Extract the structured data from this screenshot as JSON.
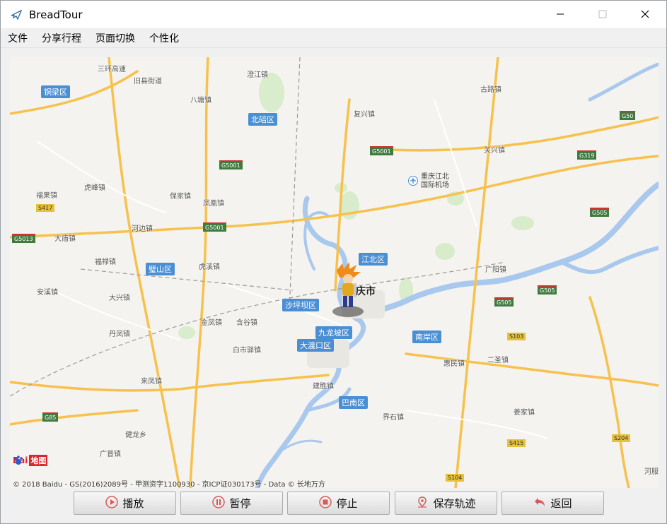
{
  "window": {
    "title": "BreadTour",
    "icon": "airplane-icon"
  },
  "window_controls": {
    "minimize": "minimize-icon",
    "maximize": "maximize-icon",
    "close": "close-icon"
  },
  "menu": {
    "items": [
      {
        "label": "文件"
      },
      {
        "label": "分享行程"
      },
      {
        "label": "页面切换"
      },
      {
        "label": "个性化"
      }
    ]
  },
  "map": {
    "colors": {
      "land": "#f4f3ef",
      "water": "#a9c8ee",
      "highway": "#f7c14d",
      "green": "#cde7c0",
      "district_label": "#4a8fd4"
    },
    "places": [
      "三环高速",
      "旧县街道",
      "澄江镇",
      "古路镇",
      "八塘镇",
      "复兴镇",
      "关兴镇",
      "福果镇",
      "虎峰镇",
      "保家镇",
      "凤凰镇",
      "河边镇",
      "大庙镇",
      "福禄镇",
      "虎溪镇",
      "广阳镇",
      "安溪镇",
      "大兴镇",
      "金凤镇",
      "含谷镇",
      "丹凤镇",
      "白市驿镇",
      "惠民镇",
      "二圣镇",
      "来凤镇",
      "建胜镇",
      "界石镇",
      "姜家镇",
      "健龙乡",
      "广普镇",
      "河服"
    ],
    "districts": [
      "铜梁区",
      "北碚区",
      "璧山区",
      "江北区",
      "沙坪坝区",
      "九龙坡区",
      "大渡口区",
      "南岸区",
      "巴南区"
    ],
    "roads": [
      "G50",
      "G5001",
      "G319",
      "G505",
      "S417",
      "G5013",
      "G5001",
      "G5001",
      "G505",
      "G505",
      "S103",
      "S415",
      "S104",
      "G85",
      "S204"
    ],
    "airport": {
      "line1": "重庆江北",
      "line2": "国际机场"
    },
    "city": "庆市",
    "logo": {
      "text": "Bai",
      "text2": "地图"
    },
    "copyright": "© 2018 Baidu - GS(2016)2089号 - 甲测资字1100930 - 京ICP证030173号 - Data © 长地万方"
  },
  "toolbar": {
    "buttons": [
      {
        "label": "播放",
        "icon": "play-icon"
      },
      {
        "label": "暂停",
        "icon": "pause-icon"
      },
      {
        "label": "停止",
        "icon": "stop-icon"
      },
      {
        "label": "保存轨迹",
        "icon": "map-pin-icon"
      },
      {
        "label": "返回",
        "icon": "back-arrow-icon"
      }
    ]
  }
}
